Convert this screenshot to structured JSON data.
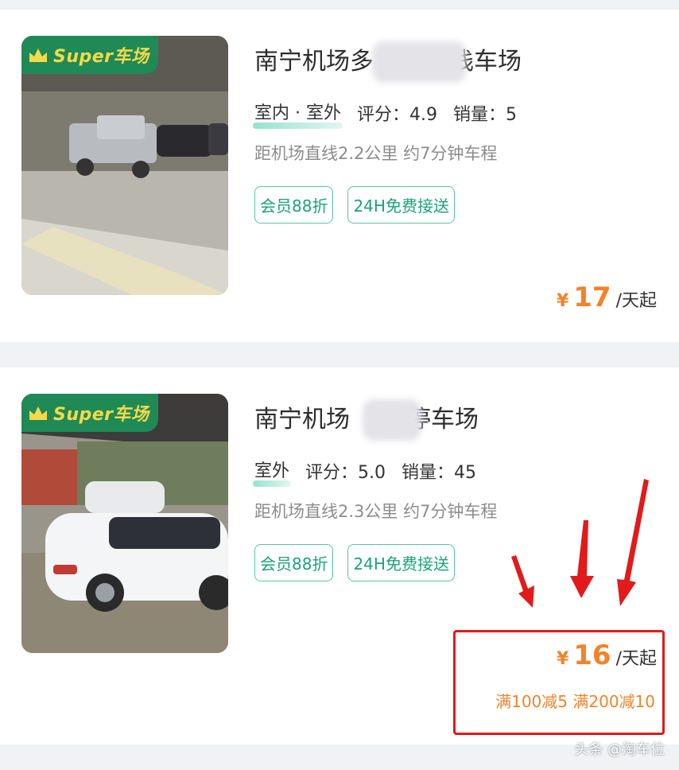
{
  "listings": [
    {
      "badge": "Super车场",
      "title": "南宁机场多",
      "title_tail": "栈车场",
      "types": "室内 · 室外",
      "rating": "评分：4.9",
      "sales": "销量：5",
      "distance": "距机场直线2.2公里 约7分钟车程",
      "tags": [
        "会员88折",
        "24H免费接送"
      ],
      "price_symbol": "¥",
      "price": "17",
      "price_unit": "/天起"
    },
    {
      "badge": "Super车场",
      "title": "南宁机场",
      "title_tail": "停车场",
      "types": "室外",
      "rating": "评分：5.0",
      "sales": "销量：45",
      "distance": "距机场直线2.3公里 约7分钟车程",
      "tags": [
        "会员88折",
        "24H免费接送"
      ],
      "price_symbol": "¥",
      "price": "16",
      "price_unit": "/天起",
      "discount": "满100减5 满200减10"
    }
  ],
  "watermark": "头条 @淘车位",
  "colors": {
    "accent_green": "#1f8a55",
    "tag_green": "#1aa37a",
    "price_orange": "#f2832a",
    "highlight_red": "#e11b1b"
  }
}
